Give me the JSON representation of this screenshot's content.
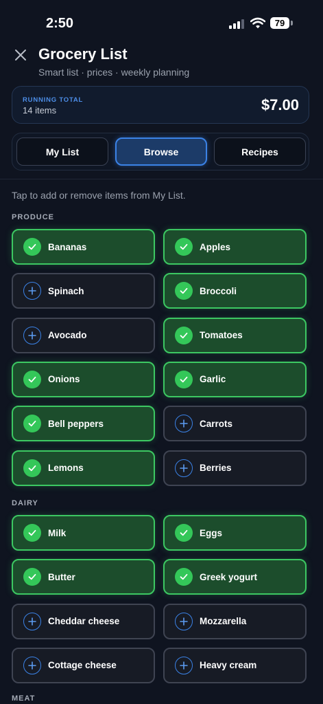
{
  "status": {
    "time": "2:50",
    "battery": "79"
  },
  "header": {
    "title": "Grocery List",
    "subtitle": "Smart list · prices · weekly planning"
  },
  "total": {
    "label": "RUNNING TOTAL",
    "count": "14 items",
    "amount": "$7.00"
  },
  "tabs": [
    {
      "label": "My List",
      "active": false
    },
    {
      "label": "Browse",
      "active": true
    },
    {
      "label": "Recipes",
      "active": false
    }
  ],
  "hint": "Tap to add or remove items from My List.",
  "sections": [
    {
      "label": "PRODUCE",
      "items": [
        {
          "name": "Bananas",
          "selected": true
        },
        {
          "name": "Apples",
          "selected": true
        },
        {
          "name": "Spinach",
          "selected": false
        },
        {
          "name": "Broccoli",
          "selected": true
        },
        {
          "name": "Avocado",
          "selected": false
        },
        {
          "name": "Tomatoes",
          "selected": true
        },
        {
          "name": "Onions",
          "selected": true
        },
        {
          "name": "Garlic",
          "selected": true
        },
        {
          "name": "Bell peppers",
          "selected": true
        },
        {
          "name": "Carrots",
          "selected": false
        },
        {
          "name": "Lemons",
          "selected": true
        },
        {
          "name": "Berries",
          "selected": false
        }
      ]
    },
    {
      "label": "DAIRY",
      "items": [
        {
          "name": "Milk",
          "selected": true
        },
        {
          "name": "Eggs",
          "selected": true
        },
        {
          "name": "Butter",
          "selected": true
        },
        {
          "name": "Greek yogurt",
          "selected": true
        },
        {
          "name": "Cheddar cheese",
          "selected": false
        },
        {
          "name": "Mozzarella",
          "selected": false
        },
        {
          "name": "Cottage cheese",
          "selected": false
        },
        {
          "name": "Heavy cream",
          "selected": false
        }
      ]
    },
    {
      "label": "MEAT",
      "items": []
    }
  ]
}
